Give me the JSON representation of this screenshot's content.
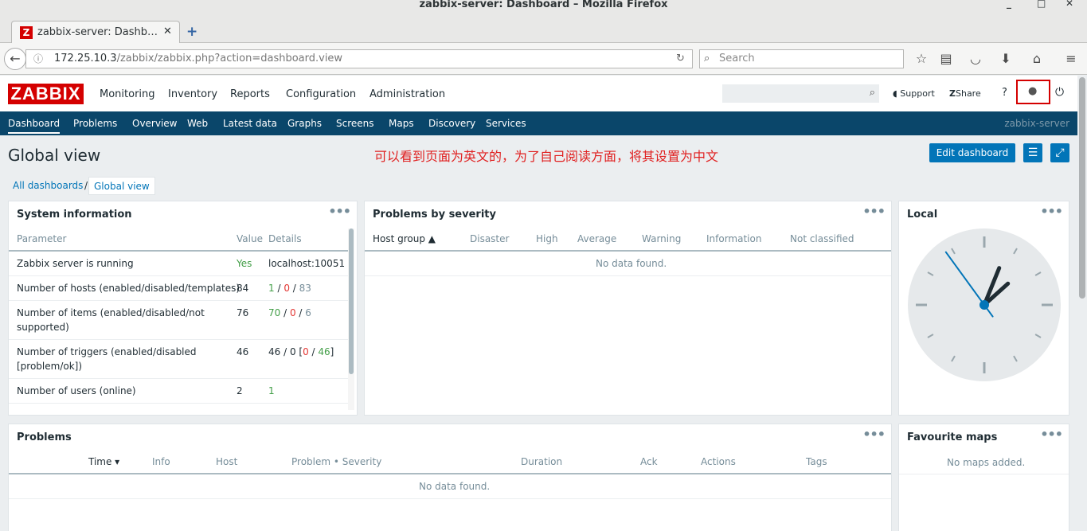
{
  "window": {
    "title": "zabbix-server: Dashboard – Mozilla Firefox",
    "tab_title": "zabbix-server: Dashb…",
    "tab_favicon": "Z",
    "url_host": "172.25.10.3",
    "url_rest": "/zabbix/zabbix.php?action=dashboard.view",
    "search_placeholder": "Search"
  },
  "header": {
    "logo": "ZABBIX",
    "menu": [
      "Monitoring",
      "Inventory",
      "Reports",
      "Configuration",
      "Administration"
    ],
    "support": "Support",
    "share": "Share",
    "help": "?"
  },
  "subnav": {
    "items": [
      "Dashboard",
      "Problems",
      "Overview",
      "Web",
      "Latest data",
      "Graphs",
      "Screens",
      "Maps",
      "Discovery",
      "Services"
    ],
    "server": "zabbix-server"
  },
  "page": {
    "title": "Global view",
    "annotation": "可以看到页面为英文的，为了自己阅读方面，将其设置为中文",
    "edit_button": "Edit dashboard",
    "breadcrumb_all": "All dashboards",
    "breadcrumb_sep": "/",
    "breadcrumb_current": "Global view"
  },
  "system_info": {
    "title": "System information",
    "headers": [
      "Parameter",
      "Value",
      "Details"
    ],
    "rows": [
      {
        "param": "Zabbix server is running",
        "value": "Yes",
        "details": "localhost:10051"
      },
      {
        "param": "Number of hosts (enabled/disabled/templates)",
        "value": "84",
        "d1": "1",
        "d2": "0",
        "d3": "83"
      },
      {
        "param1": "Number of items (enabled/disabled/not",
        "param2": "supported)",
        "value": "76",
        "d1": "70",
        "d2": "0",
        "d3": "6"
      },
      {
        "param1": "Number of triggers (enabled/disabled",
        "param2": "[problem/ok])",
        "value": "46",
        "d0": "46 / 0 [",
        "d1": "0",
        "d2": "46",
        "d3": "]"
      },
      {
        "param": "Number of users (online)",
        "value": "2",
        "details": "1"
      }
    ]
  },
  "severity": {
    "title": "Problems by severity",
    "headers": [
      "Host group ▲",
      "Disaster",
      "High",
      "Average",
      "Warning",
      "Information",
      "Not classified"
    ],
    "nodata": "No data found."
  },
  "clock": {
    "title": "Local",
    "hour": 1.6,
    "minute": 54,
    "second": 54
  },
  "problems": {
    "title": "Problems",
    "headers": [
      "Time ▾",
      "Info",
      "Host",
      "Problem • Severity",
      "Duration",
      "Ack",
      "Actions",
      "Tags"
    ],
    "nodata": "No data found."
  },
  "fav_maps": {
    "title": "Favourite maps",
    "nodata": "No maps added."
  },
  "colors": {
    "brand": "#d40000",
    "nav": "#0a466a",
    "button": "#0275b8",
    "ok": "#429e47",
    "problem": "#e33734"
  }
}
